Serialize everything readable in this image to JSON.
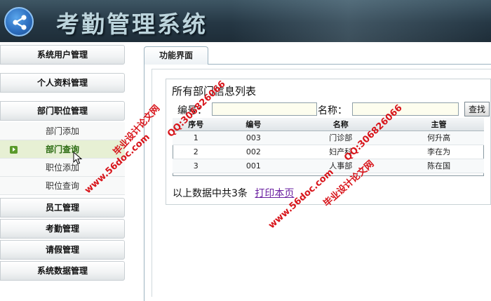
{
  "header": {
    "title": "考勤管理系统",
    "logo_icon": "share-icon"
  },
  "sidebar": {
    "groups": [
      {
        "label": "系统用户管理"
      },
      {
        "label": "个人资料管理"
      },
      {
        "label": "部门职位管理"
      }
    ],
    "sub_items": [
      {
        "label": "部门添加"
      },
      {
        "label": "部门查询",
        "active": true
      },
      {
        "label": "职位添加"
      },
      {
        "label": "职位查询"
      }
    ],
    "groups_after": [
      {
        "label": "员工管理"
      },
      {
        "label": "考勤管理"
      },
      {
        "label": "请假管理"
      },
      {
        "label": "系统数据管理"
      }
    ]
  },
  "tab": {
    "label": "功能界面"
  },
  "panel": {
    "title": "所有部门信息列表",
    "search": {
      "code_label": "编号：",
      "code_value": "",
      "name_label": "名称：",
      "name_value": "",
      "button_label": "查找"
    },
    "table": {
      "headers": [
        "序号",
        "编号",
        "名称",
        "主管"
      ],
      "rows": [
        [
          "1",
          "003",
          "门诊部",
          "何升高"
        ],
        [
          "2",
          "002",
          "妇产科",
          "李在为"
        ],
        [
          "3",
          "001",
          "人事部",
          "陈在国"
        ]
      ]
    },
    "summary": "以上数据中共3条",
    "print_label": "打印本页"
  },
  "watermarks": {
    "site_name": "毕业设计论文网",
    "url": "www.56doc.com",
    "qq": "QQ:306826066"
  },
  "colors": {
    "header_bg": "#253744",
    "accent_green": "#5a9a2a",
    "watermark_red": "#d8141a",
    "link_purple": "#6a1fa0"
  }
}
